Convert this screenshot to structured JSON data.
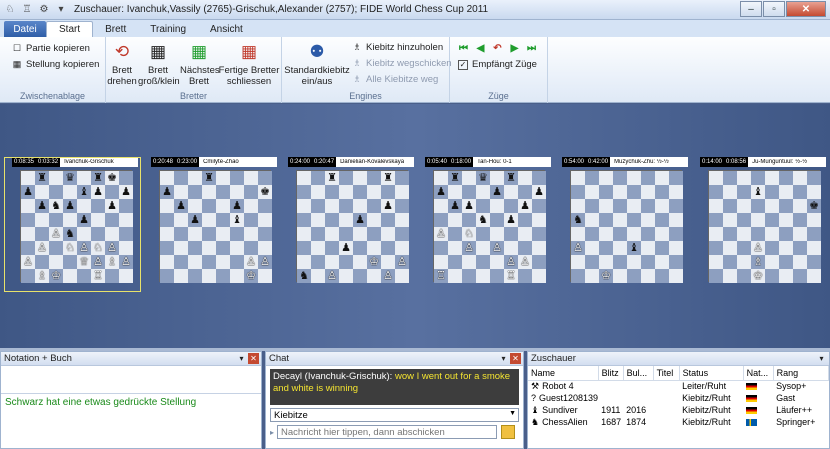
{
  "window": {
    "title": "Zuschauer: Ivanchuk,Vassily (2765)-Grischuk,Alexander (2757); FIDE World Chess Cup 2011"
  },
  "quick_access": [
    {
      "icon": "chess-app-icon"
    },
    {
      "icon": "chess-piece-icon"
    },
    {
      "icon": "settings-icon"
    },
    {
      "icon": "dropdown-icon"
    }
  ],
  "window_buttons": {
    "minimize": "–",
    "maximize": "▫",
    "close": "✕"
  },
  "tabs": [
    {
      "label": "Datei"
    },
    {
      "label": "Start"
    },
    {
      "label": "Brett"
    },
    {
      "label": "Training"
    },
    {
      "label": "Ansicht"
    }
  ],
  "ribbon": {
    "zwischenablage": {
      "label": "Zwischenablage",
      "items": [
        {
          "label": "Partie kopieren",
          "icon": "copy-icon"
        },
        {
          "label": "Stellung kopieren",
          "icon": "board-copy-icon"
        }
      ]
    },
    "bretter": {
      "label": "Bretter",
      "buttons": [
        {
          "label": "Brett drehen",
          "icon": "rotate-board-icon"
        },
        {
          "label": "Brett groß/klein",
          "icon": "resize-board-icon"
        },
        {
          "label": "Nächstes Brett",
          "icon": "next-board-icon"
        },
        {
          "label": "Fertige Bretter schliessen",
          "icon": "close-boards-icon"
        }
      ]
    },
    "engines": {
      "label": "Engines",
      "big": {
        "label": "Standardkiebitz ein/aus",
        "icon": "kibitzer-icon"
      },
      "items": [
        {
          "label": "Kiebitz hinzuholen",
          "icon": "add-kibitzer-icon",
          "enabled": true
        },
        {
          "label": "Kiebitz wegschicken",
          "icon": "remove-kibitzer-icon",
          "enabled": false
        },
        {
          "label": "Alle Kiebitze weg",
          "icon": "remove-all-kibitzers-icon",
          "enabled": false
        }
      ]
    },
    "zuege": {
      "label": "Züge",
      "nav": [
        "⏮",
        "◀",
        "↶",
        "▶",
        "⏭"
      ],
      "checkbox": {
        "label": "Empfängt Züge",
        "checked": true
      }
    }
  },
  "boards": [
    {
      "clock1": "0:08:35",
      "clock2": "0:03:32",
      "name": "Ivanchuk-Grischuk",
      "position": [
        "",
        "♜",
        "",
        "♛",
        "",
        "♜",
        "♚",
        "",
        "♟",
        "",
        "",
        "",
        "♝",
        "♟",
        "",
        "♟",
        "",
        "♟",
        "♞",
        "♟",
        "",
        "",
        "♟",
        "",
        "",
        "",
        "",
        "",
        "♟",
        "",
        "",
        "",
        "",
        "",
        "♙",
        "♞",
        "",
        "",
        "",
        "",
        "",
        "♙",
        "",
        "♘",
        "♙",
        "♘",
        "♙",
        "",
        "♙",
        "",
        "",
        "",
        "♕",
        "♙",
        "♗",
        "♙",
        "",
        "♗",
        "♔",
        "",
        "",
        "♖",
        "",
        ""
      ],
      "selected": true
    },
    {
      "clock1": "0:20:48",
      "clock2": "0:23:00",
      "name": "Cmilyte-Zhao",
      "position": [
        "",
        "",
        "",
        "♜",
        "",
        "",
        "",
        "",
        "♟",
        "",
        "",
        "",
        "",
        "",
        "",
        "♚",
        "",
        "♟",
        "",
        "",
        "",
        "♟",
        "",
        "",
        "",
        "",
        "♟",
        "",
        "",
        "♝",
        "",
        "",
        "",
        "",
        "",
        "",
        "",
        "",
        "",
        "",
        "",
        "",
        "",
        "",
        "",
        "",
        "",
        "",
        "",
        "",
        "",
        "",
        "",
        "",
        "♙",
        "♙",
        "",
        "",
        "",
        "",
        "",
        "",
        "♔",
        ""
      ],
      "selected": false
    },
    {
      "clock1": "0:24:00",
      "clock2": "0:20:47",
      "name": "Danielian-Kovalevskaya",
      "position": [
        "",
        "",
        "♜",
        "",
        "",
        "",
        "♜",
        "",
        "",
        "",
        "",
        "",
        "",
        "",
        "",
        "",
        "",
        "",
        "",
        "",
        "",
        "",
        "♟",
        "",
        "",
        "",
        "",
        "",
        "♟",
        "",
        "",
        "",
        "",
        "",
        "",
        "",
        "",
        "",
        "",
        "",
        "",
        "",
        "",
        "♟",
        "",
        "",
        "",
        "",
        "",
        "",
        "",
        "",
        "",
        "♔",
        "",
        "♙",
        "♞",
        "",
        "♙",
        "",
        "",
        "",
        "♙",
        ""
      ],
      "selected": false
    },
    {
      "clock1": "0:05:40",
      "clock2": "0:18:00",
      "name": "Tan-Hou: 0-1",
      "position": [
        "",
        "♜",
        "",
        "♛",
        "",
        "♜",
        "",
        "",
        "♟",
        "",
        "",
        "",
        "♟",
        "",
        "",
        "♟",
        "",
        "♟",
        "♟",
        "",
        "",
        "",
        "♟",
        "",
        "",
        "",
        "",
        "♞",
        "",
        "♟",
        "",
        "",
        "♙",
        "",
        "♘",
        "",
        "",
        "",
        "",
        "",
        "",
        "",
        "♙",
        "",
        "♙",
        "",
        "",
        "",
        "",
        "",
        "",
        "",
        "",
        "♙",
        "♙",
        "",
        "♖",
        "",
        "",
        "",
        "",
        "♖",
        "",
        ""
      ],
      "selected": false
    },
    {
      "clock1": "0:54:00",
      "clock2": "0:42:00",
      "name": "Muzychuk-Zhu: ½-½",
      "position": [
        "",
        "",
        "",
        "",
        "",
        "",
        "",
        "",
        "",
        "",
        "",
        "",
        "",
        "",
        "",
        "",
        "",
        "",
        "",
        "",
        "",
        "",
        "",
        "",
        "♞",
        "",
        "",
        "",
        "",
        "",
        "",
        "",
        "",
        "",
        "",
        "",
        "",
        "",
        "",
        "",
        "♙",
        "",
        "",
        "",
        "♝",
        "",
        "",
        "",
        "",
        "",
        "",
        "",
        "",
        "",
        "",
        "",
        "",
        "",
        "♔",
        "",
        "",
        "",
        "",
        ""
      ],
      "selected": false
    },
    {
      "clock1": "0:14:00",
      "clock2": "0:08:56",
      "name": "Ju-Munguntuul: ½-½",
      "position": [
        "",
        "",
        "",
        "",
        "",
        "",
        "",
        "",
        "",
        "",
        "",
        "♝",
        "",
        "",
        "",
        "",
        "",
        "",
        "",
        "",
        "",
        "",
        "",
        "♚",
        "",
        "",
        "",
        "",
        "",
        "",
        "",
        "",
        "",
        "",
        "",
        "",
        "",
        "",
        "",
        "",
        "",
        "",
        "",
        "♙",
        "",
        "",
        "",
        "",
        "",
        "",
        "",
        "♗",
        "",
        "",
        "",
        "",
        "",
        "",
        "",
        "♔",
        "",
        ""
      ],
      "selected": false
    }
  ],
  "notation_panel": {
    "title": "Notation + Buch",
    "text": "Schwarz hat eine etwas gedrückte Stellung"
  },
  "chat_panel": {
    "title": "Chat",
    "messages": [
      {
        "sender": "Decayl (Ivanchuk-Grischuk):",
        "text": "wow I went out for a smoke and white is winning"
      }
    ],
    "channel": "Kiebitze",
    "input_placeholder": "Nachricht hier tippen, dann abschicken"
  },
  "spectators_panel": {
    "title": "Zuschauer",
    "columns": [
      "Name",
      "Blitz",
      "Bul...",
      "Titel",
      "Status",
      "Nat...",
      "Rang"
    ],
    "rows": [
      {
        "icon": "⚒",
        "name": "Robot 4",
        "blitz": "",
        "bullet": "",
        "title": "",
        "status": "Leiter/Ruht",
        "flag": "de",
        "rank": "Sysop+"
      },
      {
        "icon": "?",
        "name": "Guest1208139",
        "blitz": "",
        "bullet": "",
        "title": "",
        "status": "Kiebitz/Ruht",
        "flag": "de",
        "rank": "Gast"
      },
      {
        "icon": "♝",
        "name": "Sundiver",
        "blitz": "1911",
        "bullet": "2016",
        "title": "",
        "status": "Kiebitz/Ruht",
        "flag": "de",
        "rank": "Läufer++"
      },
      {
        "icon": "♞",
        "name": "ChessAlien",
        "blitz": "1687",
        "bullet": "1874",
        "title": "",
        "status": "Kiebitz/Ruht",
        "flag": "se",
        "rank": "Springer+"
      }
    ]
  },
  "colors": {
    "ribbon_bg": "#dfe9f6",
    "board_area": "#4a5f8a",
    "light_square": "#e9edf3",
    "dark_square": "#8d9fc0",
    "selection": "#e8e26a",
    "green_text": "#1a8a1a"
  }
}
